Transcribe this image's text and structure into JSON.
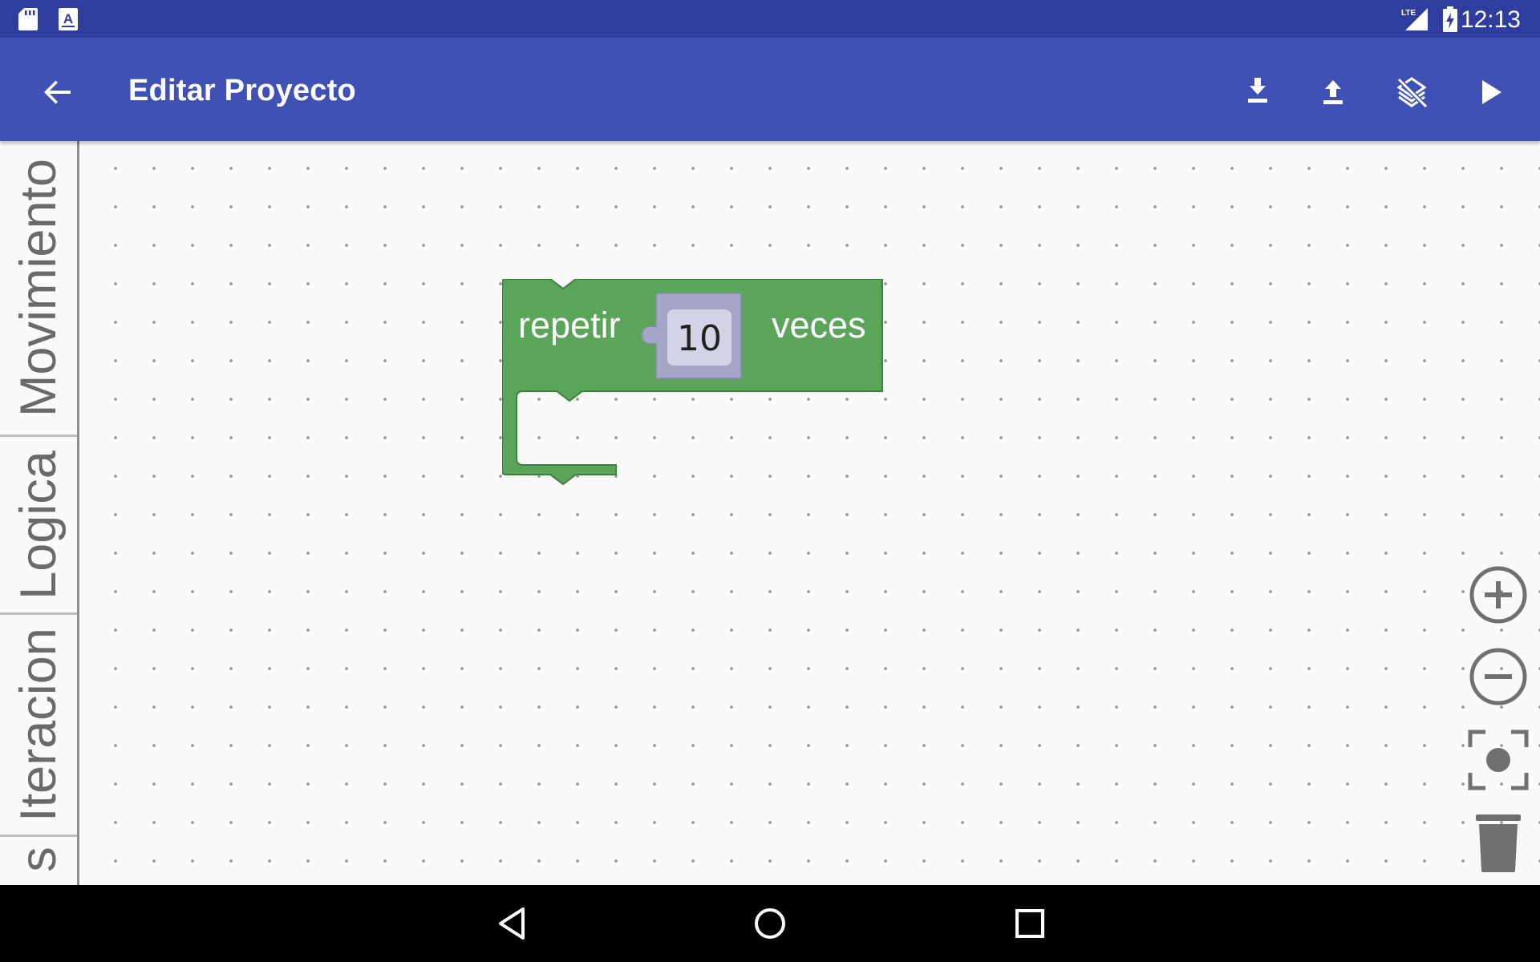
{
  "status_bar": {
    "time": "12:13",
    "network": "LTE",
    "icons": [
      "sd-card-icon",
      "text-input-icon",
      "lte-signal-icon",
      "battery-charging-icon"
    ]
  },
  "app_bar": {
    "title": "Editar Proyecto",
    "back_icon": "arrow-back-icon",
    "actions": [
      "download-icon",
      "upload-icon",
      "layers-clear-icon",
      "play-icon"
    ]
  },
  "toolbox": {
    "categories": [
      "Movimiento",
      "Logica",
      "Iteracion",
      "s"
    ]
  },
  "workspace": {
    "blocks": [
      {
        "type": "repeat",
        "label_before": "repetir",
        "value": "10",
        "label_after": "veces",
        "color": "#5ba55b",
        "input_color": "#a5a5c8"
      }
    ]
  },
  "controls": [
    "zoom-in-icon",
    "zoom-out-icon",
    "recenter-icon",
    "trash-icon"
  ],
  "nav_bar": [
    "back-triangle-icon",
    "home-circle-icon",
    "recents-square-icon"
  ],
  "colors": {
    "status_bar": "#2f3e9e",
    "app_bar": "#3f51b5",
    "workspace": "#fafafa",
    "block_green": "#5ba55b"
  }
}
